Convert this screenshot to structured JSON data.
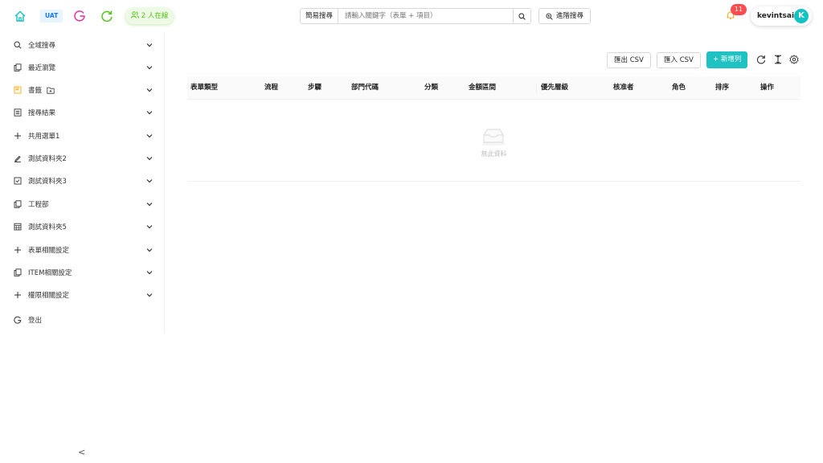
{
  "header": {
    "env_badge": "UAT",
    "online_label": "2 人在線",
    "search_mode": "簡易搜尋",
    "search_placeholder": "請輸入關鍵字（表單 + 項目）",
    "advanced_search": "進階搜尋",
    "notification_count": "11",
    "username": "kevintsai",
    "avatar_letter": "K",
    "colors": {
      "home": "#13c2c2",
      "g_icon": "#eb2f96",
      "refresh": "#52c41a",
      "online": "#52c41a",
      "badge": "#ff4d4f"
    }
  },
  "sidebar": {
    "items": [
      {
        "label": "全域搜尋",
        "icon": "search-icon"
      },
      {
        "label": "最近瀏覽",
        "icon": "copy-icon"
      },
      {
        "label": "書籤",
        "icon": "bookmark-icon"
      },
      {
        "label": "搜尋結果",
        "icon": "list-icon"
      },
      {
        "label": "共用選單1",
        "icon": "plus-icon"
      },
      {
        "label": "測試資料夾2",
        "icon": "edit-icon"
      },
      {
        "label": "測試資料夾3",
        "icon": "check-square-icon"
      },
      {
        "label": "工程部",
        "icon": "copy-icon"
      },
      {
        "label": "測試資料夾5",
        "icon": "calendar-icon"
      },
      {
        "label": "表單相關設定",
        "icon": "plus-icon"
      },
      {
        "label": "ITEM相關設定",
        "icon": "copy-icon"
      },
      {
        "label": "權限相關設定",
        "icon": "plus-icon"
      },
      {
        "label": "登出",
        "icon": "logout-icon"
      }
    ],
    "collapse_glyph": "<"
  },
  "toolbar": {
    "export_csv": "匯出 CSV",
    "import_csv": "匯入 CSV",
    "add_row": "+ 新增列"
  },
  "table": {
    "columns": [
      "表單類型",
      "流程",
      "步驟",
      "部門代碼",
      "分類",
      "金額區間",
      "優先層級",
      "核准者",
      "角色",
      "排序",
      "操作"
    ],
    "empty_text": "無此資料"
  }
}
